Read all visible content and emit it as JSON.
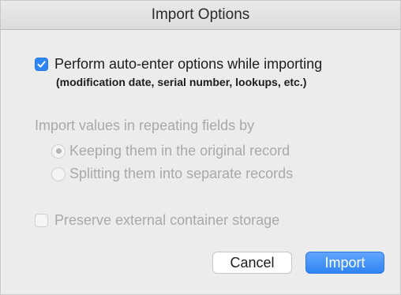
{
  "dialog": {
    "title": "Import Options",
    "auto_enter": {
      "label": "Perform auto-enter options while importing",
      "sublabel": "(modification date, serial number, lookups, etc.)",
      "checked": true
    },
    "repeating": {
      "heading": "Import values in repeating fields by",
      "options": [
        {
          "label": "Keeping them in the original record",
          "selected": true
        },
        {
          "label": "Splitting them into separate records",
          "selected": false
        }
      ]
    },
    "preserve": {
      "label": "Preserve external container storage",
      "checked": false
    },
    "buttons": {
      "cancel": "Cancel",
      "import": "Import"
    }
  },
  "colors": {
    "accent": "#2e86f5",
    "disabled_text": "#a9a9a9",
    "background": "#ececec"
  }
}
